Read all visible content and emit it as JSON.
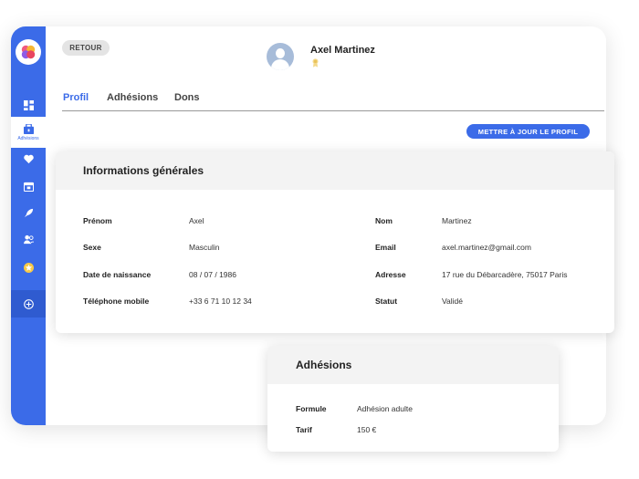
{
  "app": {
    "brand_color": "#3b6be8",
    "sidebar_active_label": "Adhésions"
  },
  "sidebar": {
    "icons": [
      "dashboard-icon",
      "membership-icon",
      "heart-icon",
      "calendar-icon",
      "rocket-icon",
      "users-icon",
      "star-icon",
      "plus-circle-icon"
    ]
  },
  "header": {
    "back_label": "RETOUR",
    "user_name": "Axel Martinez"
  },
  "tabs": [
    {
      "label": "Profil",
      "active": true
    },
    {
      "label": "Adhésions",
      "active": false
    },
    {
      "label": "Dons",
      "active": false
    }
  ],
  "actions": {
    "update_profile_label": "METTRE À JOUR LE PROFIL"
  },
  "general_info": {
    "title": "Informations générales",
    "left": [
      {
        "label": "Prénom",
        "value": "Axel"
      },
      {
        "label": "Sexe",
        "value": "Masculin"
      },
      {
        "label": "Date de naissance",
        "value": "08 / 07 / 1986"
      },
      {
        "label": "Téléphone mobile",
        "value": "+33 6 71 10 12 34"
      }
    ],
    "right": [
      {
        "label": "Nom",
        "value": "Martinez"
      },
      {
        "label": "Email",
        "value": "axel.martinez@gmail.com"
      },
      {
        "label": "Adresse",
        "value": "17 rue du Débarcadère, 75017 Paris"
      },
      {
        "label": "Statut",
        "value": "Validé"
      }
    ]
  },
  "memberships": {
    "title": "Adhésions",
    "rows": [
      {
        "label": "Formule",
        "value": "Adhésion adulte"
      },
      {
        "label": "Tarif",
        "value": "150 €"
      }
    ]
  }
}
